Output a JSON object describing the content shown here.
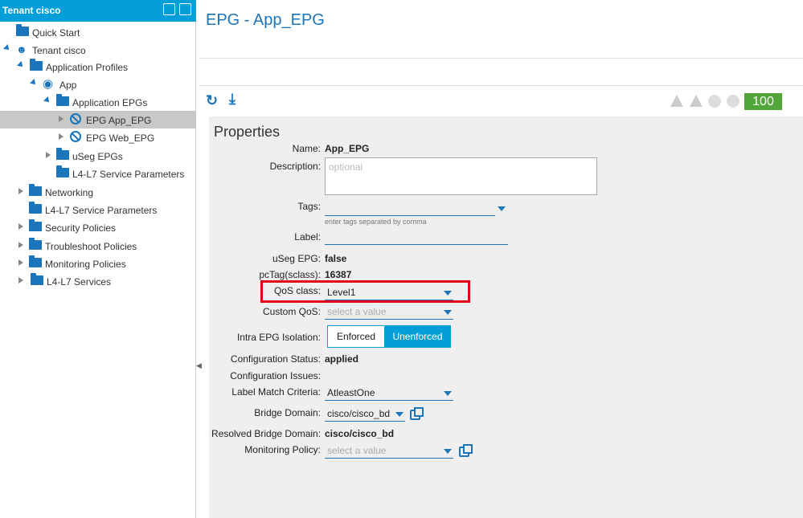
{
  "sidebar": {
    "title": "Tenant cisco",
    "items": [
      {
        "label": "Quick Start"
      },
      {
        "label": "Tenant cisco"
      },
      {
        "label": "Application Profiles"
      },
      {
        "label": "App"
      },
      {
        "label": "Application EPGs"
      },
      {
        "label": "EPG App_EPG"
      },
      {
        "label": "EPG Web_EPG"
      },
      {
        "label": "uSeg EPGs"
      },
      {
        "label": "L4-L7 Service Parameters"
      },
      {
        "label": "Networking"
      },
      {
        "label": "L4-L7 Service Parameters"
      },
      {
        "label": "Security Policies"
      },
      {
        "label": "Troubleshoot Policies"
      },
      {
        "label": "Monitoring Policies"
      },
      {
        "label": "L4-L7 Services"
      }
    ]
  },
  "header": {
    "title": "EPG - App_EPG"
  },
  "toolbar": {
    "health": "100"
  },
  "properties": {
    "title": "Properties",
    "name_label": "Name:",
    "name_value": "App_EPG",
    "description_label": "Description:",
    "description_placeholder": "optional",
    "tags_label": "Tags:",
    "tags_hint": "enter tags separated by comma",
    "label_label": "Label:",
    "useg_label": "uSeg EPG:",
    "useg_value": "false",
    "pctag_label": "pcTag(sclass):",
    "pctag_value": "16387",
    "qos_label": "QoS class:",
    "qos_value": "Level1",
    "custom_qos_label": "Custom QoS:",
    "custom_qos_placeholder": "select a value",
    "isolation_label": "Intra EPG Isolation:",
    "isolation_options": [
      "Enforced",
      "Unenforced"
    ],
    "isolation_selected": "Unenforced",
    "config_status_label": "Configuration Status:",
    "config_status_value": "applied",
    "config_issues_label": "Configuration Issues:",
    "label_match_label": "Label Match Criteria:",
    "label_match_value": "AtleastOne",
    "bridge_domain_label": "Bridge Domain:",
    "bridge_domain_value": "cisco/cisco_bd",
    "resolved_bd_label": "Resolved Bridge Domain:",
    "resolved_bd_value": "cisco/cisco_bd",
    "monitoring_label": "Monitoring Policy:",
    "monitoring_placeholder": "select a value"
  },
  "colors": {
    "accent": "#049fd9",
    "link": "#1a75bb",
    "health": "#52a539",
    "highlight": "#e2001a"
  }
}
